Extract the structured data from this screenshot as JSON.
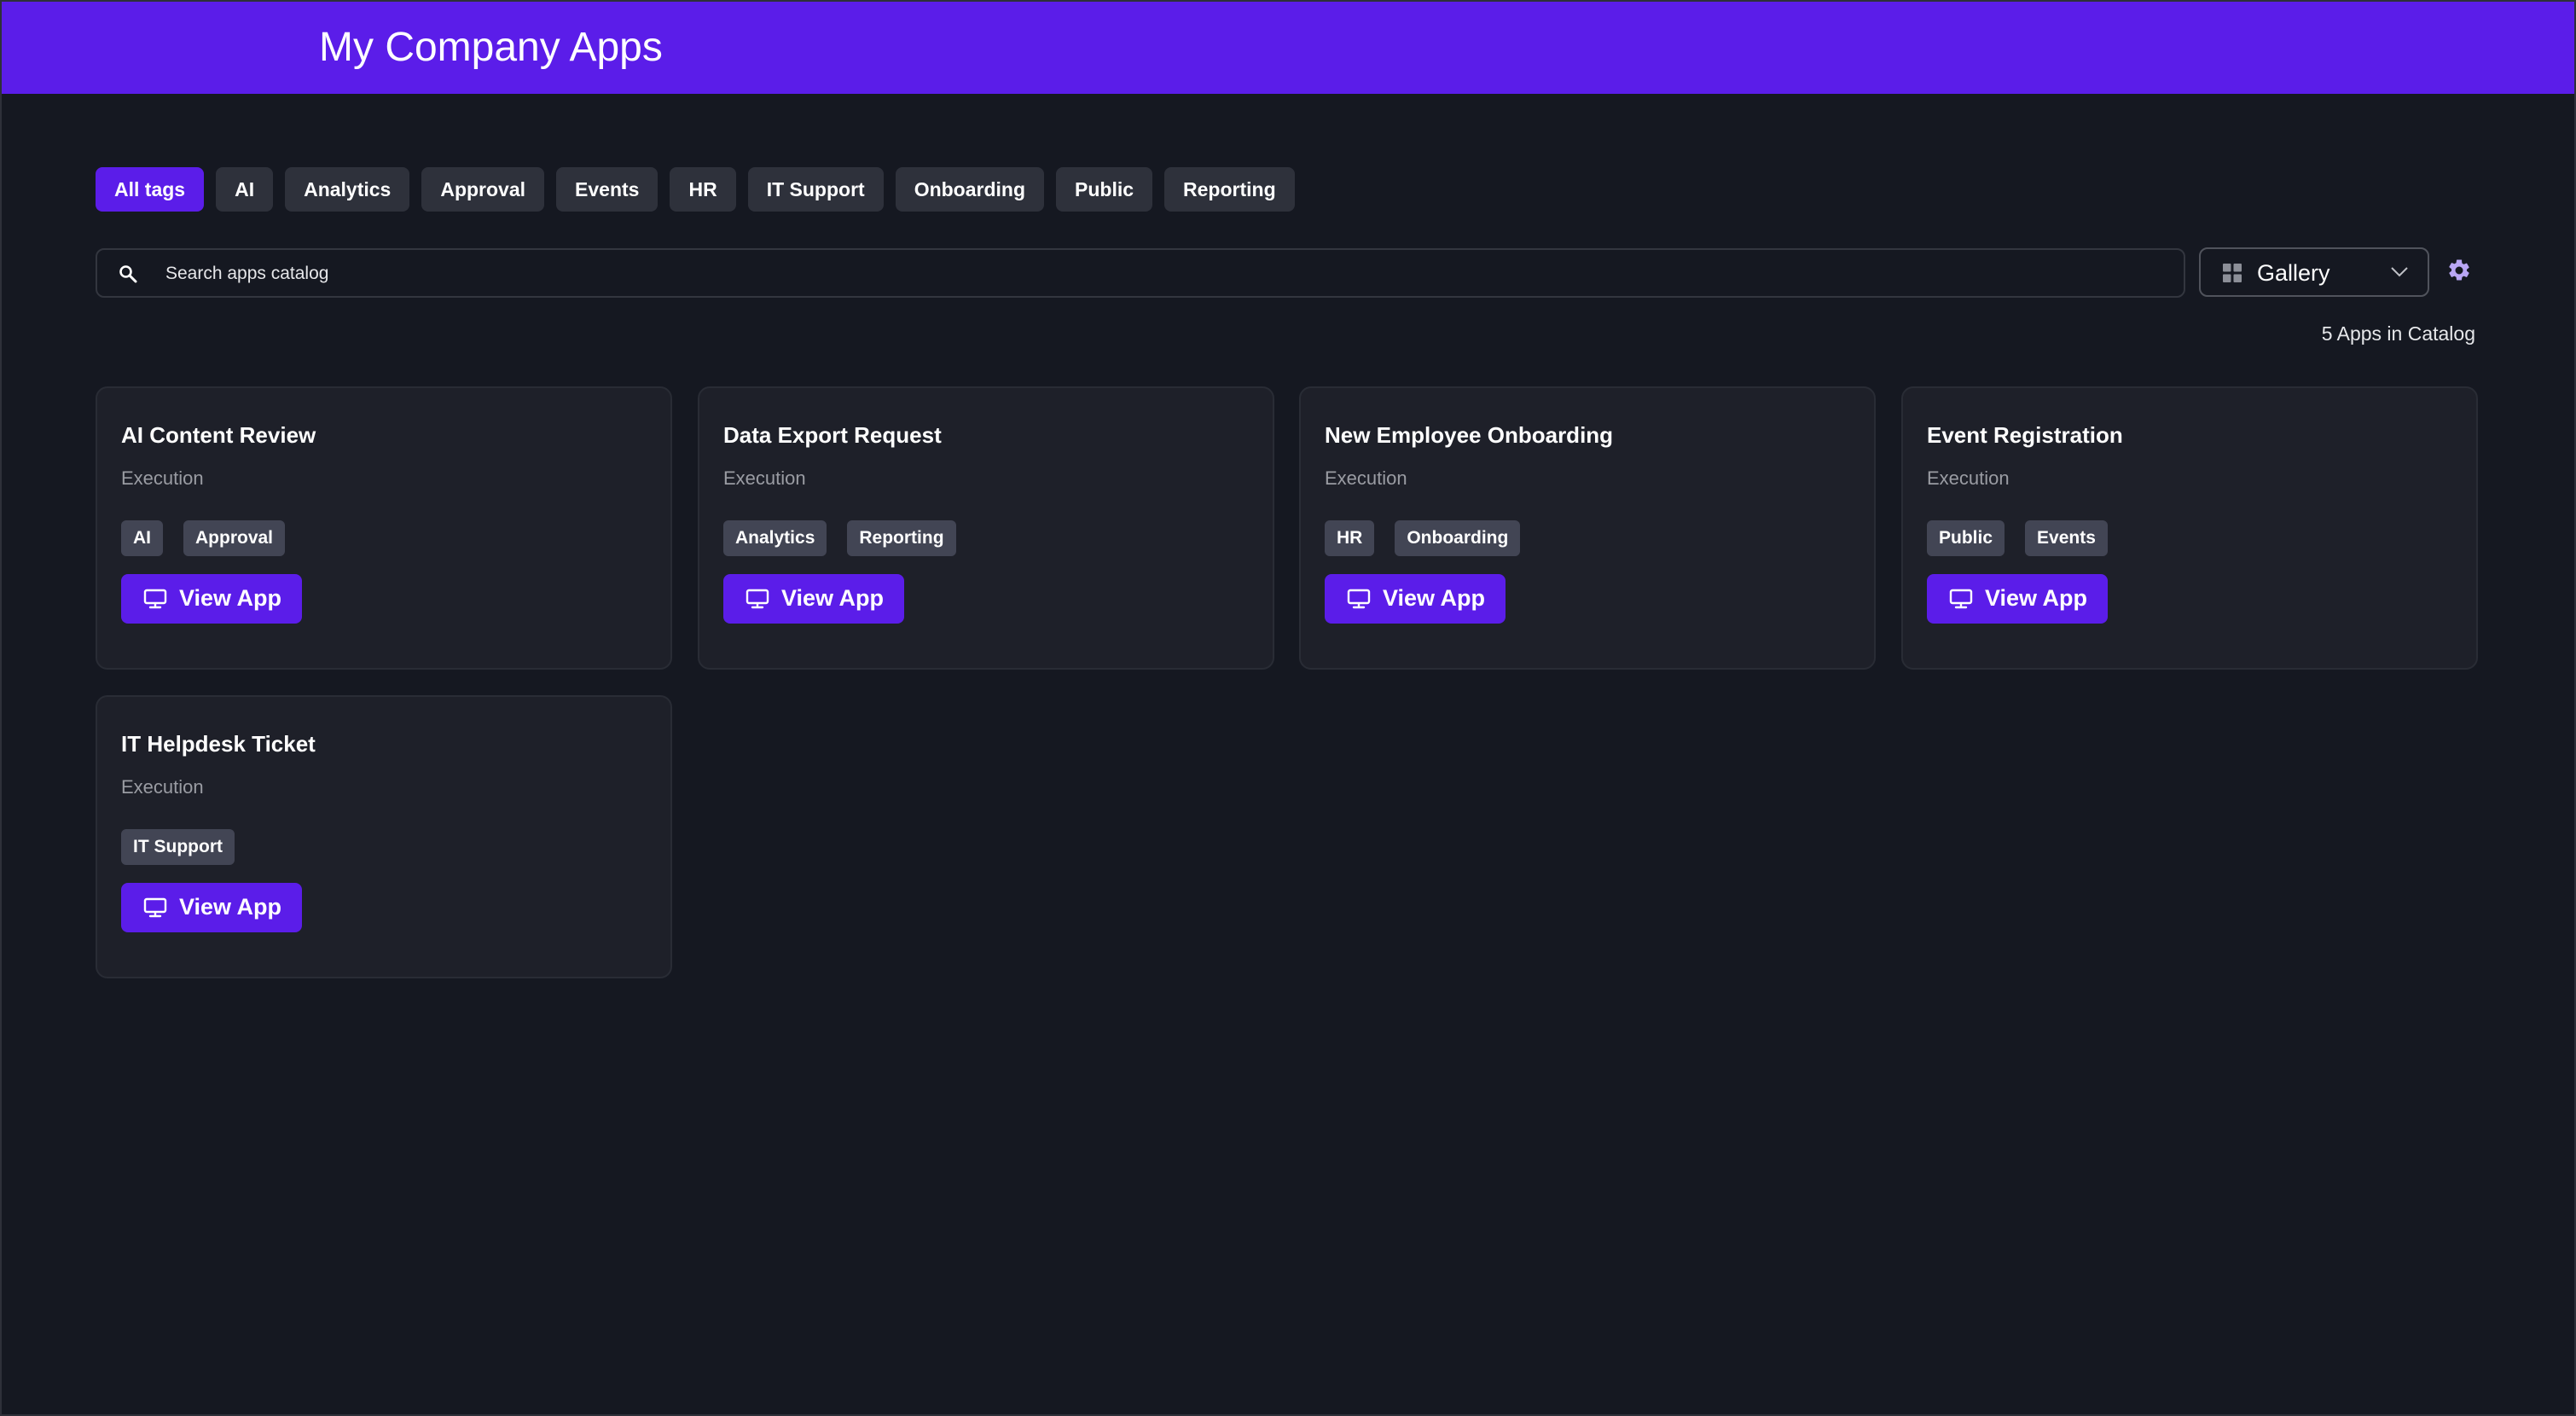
{
  "header": {
    "title": "My Company Apps"
  },
  "tag_filters": [
    "All tags",
    "AI",
    "Analytics",
    "Approval",
    "Events",
    "HR",
    "IT Support",
    "Onboarding",
    "Public",
    "Reporting"
  ],
  "active_tag": "All tags",
  "search": {
    "placeholder": "Search apps catalog",
    "value": ""
  },
  "view_select": {
    "selected": "Gallery"
  },
  "catalog_count": "5 Apps in Catalog",
  "apps": [
    {
      "name": "AI Content Review",
      "subtitle": "Execution",
      "tags": [
        "AI",
        "Approval"
      ],
      "button_label": "View App"
    },
    {
      "name": "Data Export Request",
      "subtitle": "Execution",
      "tags": [
        "Analytics",
        "Reporting"
      ],
      "button_label": "View App"
    },
    {
      "name": "New Employee Onboarding",
      "subtitle": "Execution",
      "tags": [
        "HR",
        "Onboarding"
      ],
      "button_label": "View App"
    },
    {
      "name": "Event Registration",
      "subtitle": "Execution",
      "tags": [
        "Public",
        "Events"
      ],
      "button_label": "View App"
    },
    {
      "name": "IT Helpdesk Ticket",
      "subtitle": "Execution",
      "tags": [
        "IT Support"
      ],
      "button_label": "View App"
    }
  ],
  "colors": {
    "brand": "#5b1de9",
    "background": "#151821",
    "card": "#1e2029",
    "tag": "#424554"
  }
}
